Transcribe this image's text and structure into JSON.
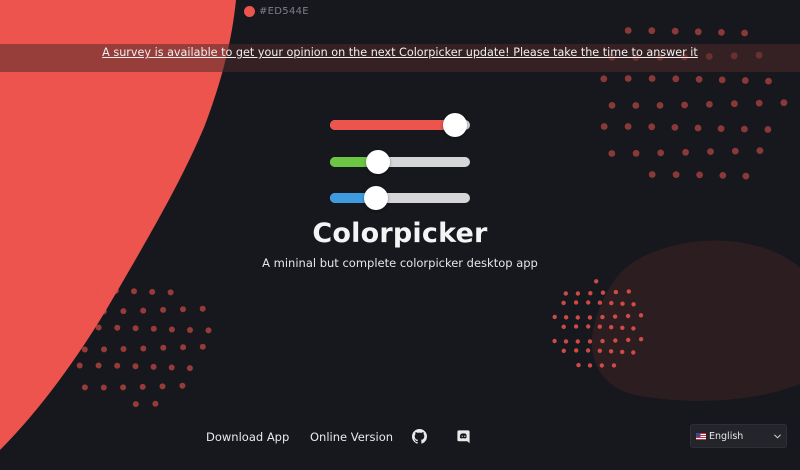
{
  "header": {
    "color_hex": "#ED544E"
  },
  "survey": {
    "text": "A survey is available to get your opinion on the next Colorpicker update! Please take the time to answer it"
  },
  "sliders": [
    {
      "channel": "red",
      "level": 0.89,
      "color": "#ED544E"
    },
    {
      "channel": "green",
      "level": 0.34,
      "color": "#6cc644"
    },
    {
      "channel": "blue",
      "level": 0.33,
      "color": "#3f9be0"
    }
  ],
  "hero": {
    "title": "Colorpicker",
    "tagline": "A mininal but complete colorpicker desktop app"
  },
  "footer": {
    "download_label": "Download App",
    "online_label": "Online Version",
    "github_icon": "github-icon",
    "discord_icon": "discord-icon",
    "language": "English"
  },
  "colors": {
    "accent": "#ED544E",
    "background": "#16181d"
  }
}
